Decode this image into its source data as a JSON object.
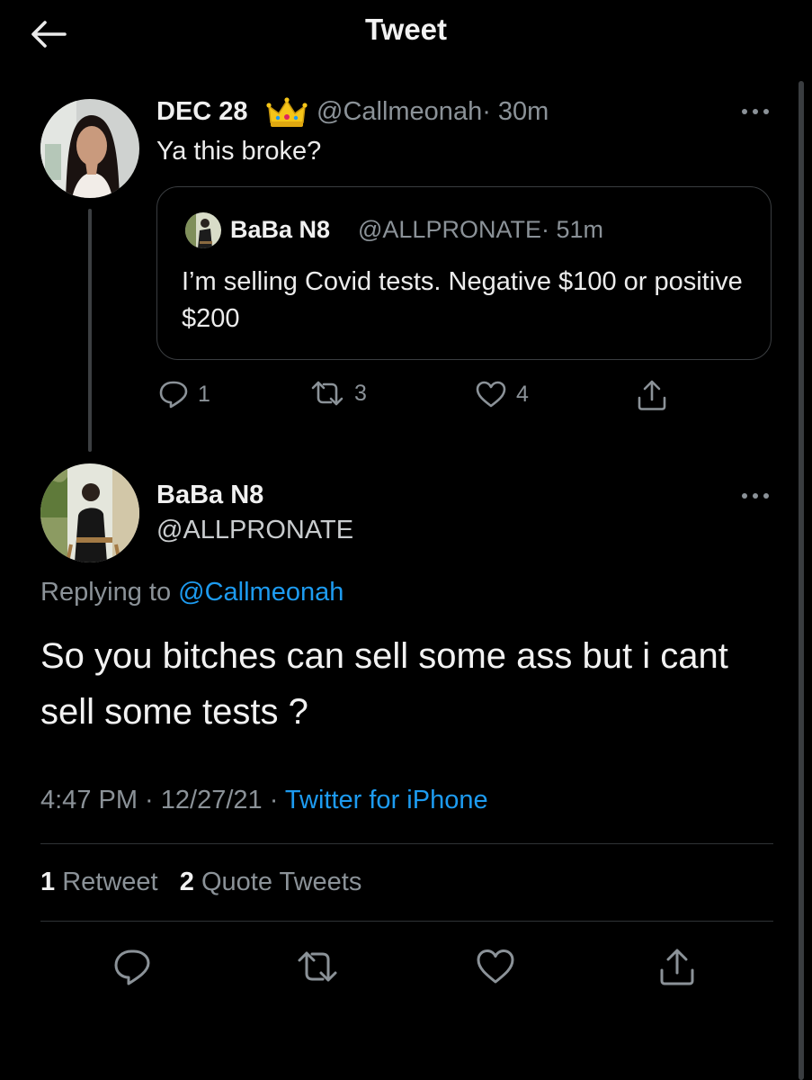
{
  "header": {
    "title": "Tweet",
    "back_icon": "arrow-left-icon"
  },
  "tweet1": {
    "name": "DEC 28",
    "badge_icon": "crown-emoji-icon",
    "handle": "@Callmeonah",
    "time": "· 30m",
    "text": "Ya this broke?",
    "quote": {
      "name": "BaBa N8",
      "handle": "@ALLPRONATE",
      "time": "· 51m",
      "text": "I’m selling Covid tests. Negative $100 or positive $200"
    },
    "actions": {
      "replies": "1",
      "retweets": "3",
      "likes": "4"
    }
  },
  "tweet2": {
    "name": "BaBa N8",
    "handle": "@ALLPRONATE",
    "replying_label": "Replying to",
    "replying_handle": "@Callmeonah",
    "text": "So you bitches can sell some ass but i cant sell some tests ?",
    "time": "4:47 PM",
    "sep1": " · ",
    "date": "12/27/21",
    "sep2": " · ",
    "source": "Twitter for iPhone",
    "stats": {
      "retweet_count": "1",
      "retweet_label": " Retweet",
      "quote_count": "2",
      "quote_label": " Quote Tweets"
    }
  },
  "colors": {
    "background": "#000000",
    "link": "#1d9bf0",
    "muted": "#8b9298",
    "divider": "#2f3336"
  }
}
